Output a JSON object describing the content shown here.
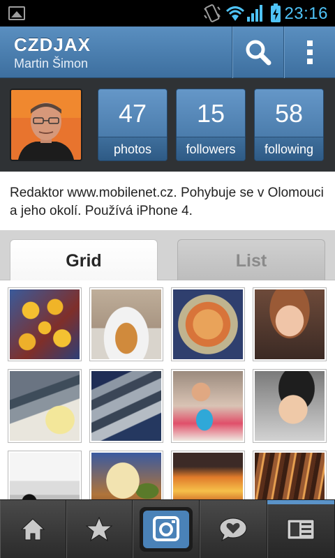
{
  "status_bar": {
    "time": "23:16",
    "icons": [
      "gallery-notification-icon",
      "vibrate-icon",
      "wifi-icon",
      "signal-icon",
      "battery-icon"
    ]
  },
  "header": {
    "username": "CZDJAX",
    "full_name": "Martin Šimon",
    "actions": [
      "search-icon",
      "overflow-menu-icon"
    ]
  },
  "stats": [
    {
      "count": "47",
      "label": "photos"
    },
    {
      "count": "15",
      "label": "followers"
    },
    {
      "count": "58",
      "label": "following"
    }
  ],
  "bio": "Redaktor www.mobilenet.cz. Pohybuje se v Olomouci a jeho okolí. Používá iPhone 4.",
  "tabs": {
    "grid": "Grid",
    "list": "List",
    "selected": "Grid"
  },
  "bottom_nav": {
    "items": [
      "home-icon",
      "star-icon",
      "camera-icon",
      "heart-speech-icon",
      "profile-icon"
    ],
    "selected": "profile-icon"
  },
  "colors": {
    "accent_blue": "#4a7fb2",
    "status_blue": "#4fc3f7",
    "dark_band": "#2f3235"
  }
}
